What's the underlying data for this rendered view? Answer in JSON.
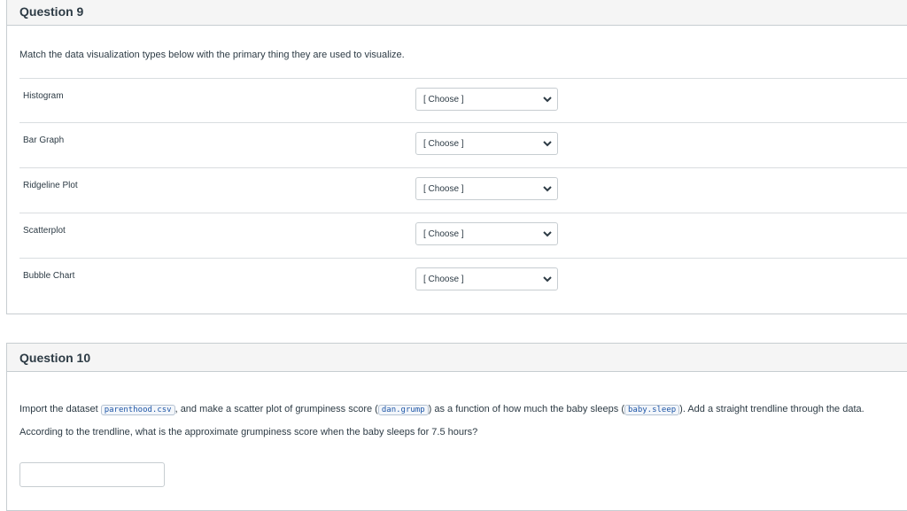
{
  "q9": {
    "title": "Question 9",
    "prompt": "Match the data visualization types below with the primary thing they are used to visualize.",
    "rows": [
      {
        "label": "Histogram",
        "selected": "[ Choose ]"
      },
      {
        "label": "Bar Graph",
        "selected": "[ Choose ]"
      },
      {
        "label": "Ridgeline Plot",
        "selected": "[ Choose ]"
      },
      {
        "label": "Scatterplot",
        "selected": "[ Choose ]"
      },
      {
        "label": "Bubble Chart",
        "selected": "[ Choose ]"
      }
    ]
  },
  "q10": {
    "title": "Question 10",
    "line1": {
      "t1": "Import the dataset ",
      "code1": "parenthood.csv",
      "t2": ", and make a scatter plot of grumpiness score (",
      "code2": "dan.grump",
      "t3": ") as a function of how much the baby sleeps (",
      "code3": "baby.sleep",
      "t4": "). Add a straight trendline through the data."
    },
    "line2": "According to the trendline, what is the approximate grumpiness score when the baby sleeps for 7.5 hours?",
    "answer_value": ""
  },
  "icons": {
    "select_arrow": "chevron-down-icon"
  }
}
